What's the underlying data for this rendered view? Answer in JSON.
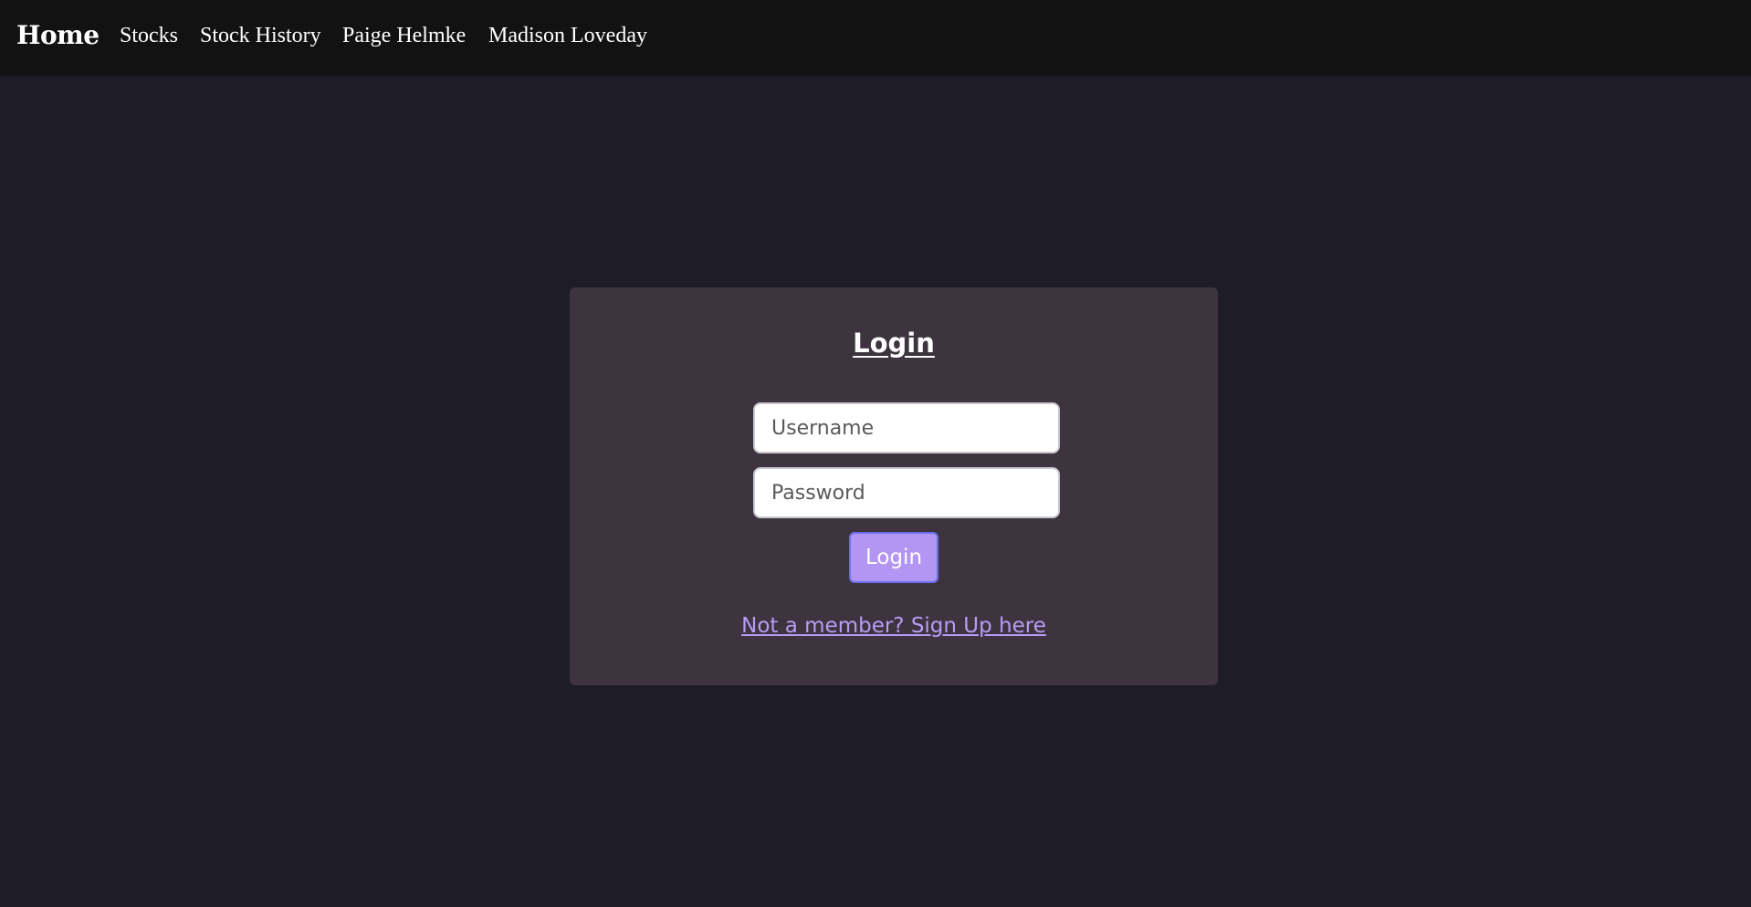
{
  "navbar": {
    "brand": "Home",
    "links": [
      "Stocks",
      "Stock History",
      "Paige Helmke",
      "Madison Loveday"
    ]
  },
  "login_card": {
    "title": "Login",
    "username_placeholder": "Username",
    "password_placeholder": "Password",
    "submit_label": "Login",
    "signup_link": "Not a member? Sign Up here"
  },
  "colors": {
    "page_background": "#1e1c27",
    "navbar_background": "#121212",
    "card_background": "#3d343f",
    "button_accent": "#b396f4",
    "link_color": "#b79cf5"
  }
}
